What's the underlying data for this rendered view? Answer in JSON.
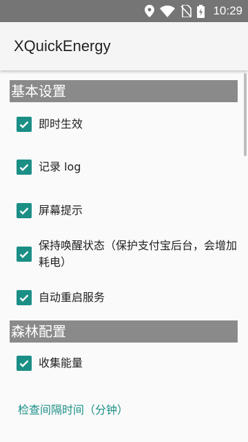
{
  "status_bar": {
    "time": "10:29",
    "icons": [
      "location-icon",
      "wifi-icon",
      "no-sim-icon",
      "battery-charging-icon"
    ]
  },
  "app_bar": {
    "title": "XQuickEnergy"
  },
  "sections": [
    {
      "title": "基本设置"
    },
    {
      "title": "森林配置"
    }
  ],
  "settings": [
    {
      "label": "即时生效",
      "checked": true
    },
    {
      "label": "记录 log",
      "checked": true
    },
    {
      "label": "屏幕提示",
      "checked": true
    },
    {
      "label": "保持唤醒状态（保护支付宝后台，会增加耗电）",
      "checked": true
    },
    {
      "label": "自动重启服务",
      "checked": true
    },
    {
      "label": "收集能量",
      "checked": true
    }
  ],
  "links": {
    "check_interval": "检查间隔时间（分钟）"
  },
  "colors": {
    "accent": "#1b8f86",
    "section_bg": "#8a8a8a",
    "status_bar": "#757575"
  }
}
